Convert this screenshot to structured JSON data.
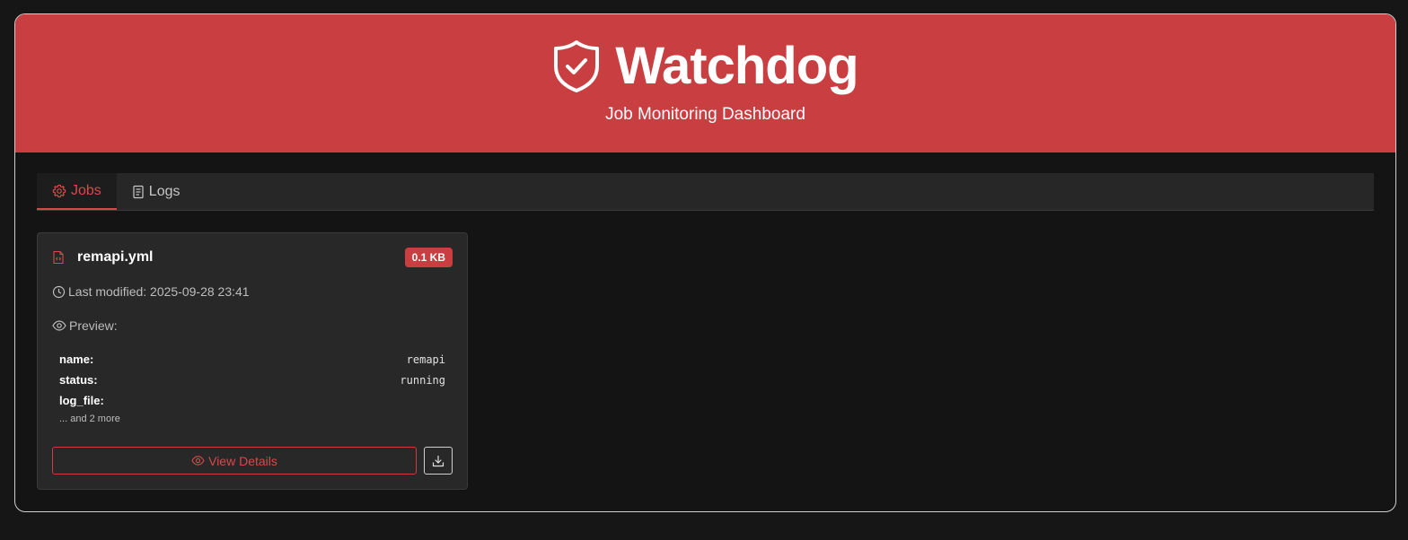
{
  "header": {
    "title": "Watchdog",
    "subtitle": "Job Monitoring Dashboard",
    "icon": "shield-check-icon"
  },
  "tabs": [
    {
      "label": "Jobs",
      "icon": "gear-icon",
      "active": true
    },
    {
      "label": "Logs",
      "icon": "document-icon",
      "active": false
    }
  ],
  "job_card": {
    "file_name": "remapi.yml",
    "file_icon": "code-file-icon",
    "size_badge": "0.1 KB",
    "last_modified": "Last modified: 2025-09-28 23:41",
    "preview_label": "Preview:",
    "preview_rows": [
      {
        "key": "name:",
        "value": "remapi"
      },
      {
        "key": "status:",
        "value": "running"
      },
      {
        "key": "log_file:",
        "value": ""
      }
    ],
    "more_text": "... and 2 more",
    "view_details_label": "View Details"
  },
  "colors": {
    "accent": "#c93e41",
    "accent_text": "#d9494b",
    "background": "#141414",
    "card": "#282828"
  }
}
